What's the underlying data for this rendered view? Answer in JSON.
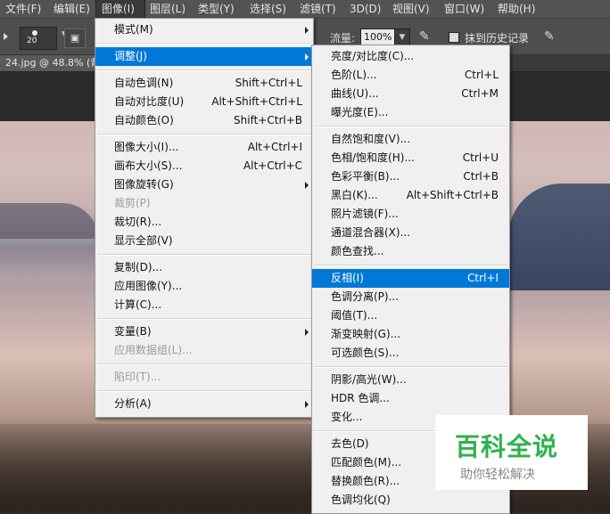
{
  "menubar": {
    "items": [
      "文件(F)",
      "编辑(E)",
      "图像(I)",
      "图层(L)",
      "类型(Y)",
      "选择(S)",
      "滤镜(T)",
      "3D(D)",
      "视图(V)",
      "窗口(W)",
      "帮助(H)"
    ],
    "active": "图像(I)"
  },
  "options": {
    "brush_size": "20",
    "flow_label": "流量:",
    "flow_value": "100%",
    "history_label": "抹到历史记录"
  },
  "document": {
    "tab": "24.jpg @ 48.8% (背"
  },
  "image_menu": {
    "items": [
      {
        "label": "模式(M)",
        "shortcut": "",
        "submenu": true,
        "disabled": false,
        "highlighted": false
      },
      {
        "sep": true
      },
      {
        "label": "调整(J)",
        "shortcut": "",
        "submenu": true,
        "disabled": false,
        "highlighted": true
      },
      {
        "sep": true
      },
      {
        "label": "自动色调(N)",
        "shortcut": "Shift+Ctrl+L",
        "submenu": false,
        "disabled": false,
        "highlighted": false
      },
      {
        "label": "自动对比度(U)",
        "shortcut": "Alt+Shift+Ctrl+L",
        "submenu": false,
        "disabled": false,
        "highlighted": false
      },
      {
        "label": "自动颜色(O)",
        "shortcut": "Shift+Ctrl+B",
        "submenu": false,
        "disabled": false,
        "highlighted": false
      },
      {
        "sep": true
      },
      {
        "label": "图像大小(I)...",
        "shortcut": "Alt+Ctrl+I",
        "submenu": false,
        "disabled": false,
        "highlighted": false
      },
      {
        "label": "画布大小(S)...",
        "shortcut": "Alt+Ctrl+C",
        "submenu": false,
        "disabled": false,
        "highlighted": false
      },
      {
        "label": "图像旋转(G)",
        "shortcut": "",
        "submenu": true,
        "disabled": false,
        "highlighted": false
      },
      {
        "label": "裁剪(P)",
        "shortcut": "",
        "submenu": false,
        "disabled": true,
        "highlighted": false
      },
      {
        "label": "裁切(R)...",
        "shortcut": "",
        "submenu": false,
        "disabled": false,
        "highlighted": false
      },
      {
        "label": "显示全部(V)",
        "shortcut": "",
        "submenu": false,
        "disabled": false,
        "highlighted": false
      },
      {
        "sep": true
      },
      {
        "label": "复制(D)...",
        "shortcut": "",
        "submenu": false,
        "disabled": false,
        "highlighted": false
      },
      {
        "label": "应用图像(Y)...",
        "shortcut": "",
        "submenu": false,
        "disabled": false,
        "highlighted": false
      },
      {
        "label": "计算(C)...",
        "shortcut": "",
        "submenu": false,
        "disabled": false,
        "highlighted": false
      },
      {
        "sep": true
      },
      {
        "label": "变量(B)",
        "shortcut": "",
        "submenu": true,
        "disabled": false,
        "highlighted": false
      },
      {
        "label": "应用数据组(L)...",
        "shortcut": "",
        "submenu": false,
        "disabled": true,
        "highlighted": false
      },
      {
        "sep": true
      },
      {
        "label": "陷印(T)...",
        "shortcut": "",
        "submenu": false,
        "disabled": true,
        "highlighted": false
      },
      {
        "sep": true
      },
      {
        "label": "分析(A)",
        "shortcut": "",
        "submenu": true,
        "disabled": false,
        "highlighted": false
      }
    ]
  },
  "adjust_menu": {
    "items": [
      {
        "label": "亮度/对比度(C)...",
        "shortcut": "",
        "highlighted": false
      },
      {
        "label": "色阶(L)...",
        "shortcut": "Ctrl+L",
        "highlighted": false
      },
      {
        "label": "曲线(U)...",
        "shortcut": "Ctrl+M",
        "highlighted": false
      },
      {
        "label": "曝光度(E)...",
        "shortcut": "",
        "highlighted": false
      },
      {
        "sep": true
      },
      {
        "label": "自然饱和度(V)...",
        "shortcut": "",
        "highlighted": false
      },
      {
        "label": "色相/饱和度(H)...",
        "shortcut": "Ctrl+U",
        "highlighted": false
      },
      {
        "label": "色彩平衡(B)...",
        "shortcut": "Ctrl+B",
        "highlighted": false
      },
      {
        "label": "黑白(K)...",
        "shortcut": "Alt+Shift+Ctrl+B",
        "highlighted": false
      },
      {
        "label": "照片滤镜(F)...",
        "shortcut": "",
        "highlighted": false
      },
      {
        "label": "通道混合器(X)...",
        "shortcut": "",
        "highlighted": false
      },
      {
        "label": "颜色查找...",
        "shortcut": "",
        "highlighted": false
      },
      {
        "sep": true
      },
      {
        "label": "反相(I)",
        "shortcut": "Ctrl+I",
        "highlighted": true
      },
      {
        "label": "色调分离(P)...",
        "shortcut": "",
        "highlighted": false
      },
      {
        "label": "阈值(T)...",
        "shortcut": "",
        "highlighted": false
      },
      {
        "label": "渐变映射(G)...",
        "shortcut": "",
        "highlighted": false
      },
      {
        "label": "可选颜色(S)...",
        "shortcut": "",
        "highlighted": false
      },
      {
        "sep": true
      },
      {
        "label": "阴影/高光(W)...",
        "shortcut": "",
        "highlighted": false
      },
      {
        "label": "HDR 色调...",
        "shortcut": "",
        "highlighted": false
      },
      {
        "label": "变化...",
        "shortcut": "",
        "highlighted": false
      },
      {
        "sep": true
      },
      {
        "label": "去色(D)",
        "shortcut": "S",
        "highlighted": false
      },
      {
        "label": "匹配颜色(M)...",
        "shortcut": "",
        "highlighted": false
      },
      {
        "label": "替换颜色(R)...",
        "shortcut": "",
        "highlighted": false
      },
      {
        "label": "色调均化(Q)",
        "shortcut": "",
        "highlighted": false
      }
    ]
  },
  "watermark": {
    "title": "百科全说",
    "subtitle": "助你轻松解决"
  }
}
